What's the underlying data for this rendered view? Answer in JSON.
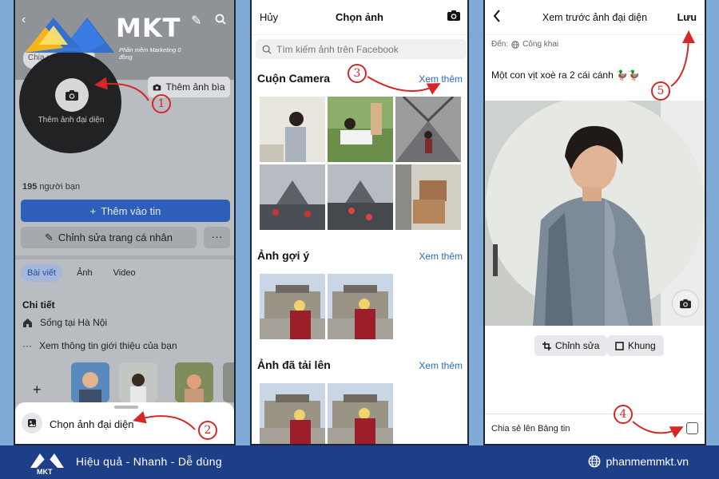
{
  "panel1": {
    "logo": {
      "text": "MKT",
      "subtitle": "Phần mềm Marketing 0 đồng"
    },
    "share_placeholder": "Chia sẻ bài hát...",
    "avatar_label": "Thêm ảnh đại diện",
    "add_cover_label": "Thêm ảnh bìa",
    "friends_count": "195",
    "friends_label": "người bạn",
    "add_story_label": "Thêm vào tin",
    "edit_profile_label": "Chỉnh sửa trang cá nhân",
    "more_label": "···",
    "tabs": [
      {
        "label": "Bài viết",
        "active": true
      },
      {
        "label": "Ảnh",
        "active": false
      },
      {
        "label": "Video",
        "active": false
      }
    ],
    "details_title": "Chi tiết",
    "lives_in_prefix": "Sống tại",
    "lives_in_city": "Hà Nội",
    "see_about": "Xem thông tin giới thiệu của bạn",
    "add_label": "+",
    "sheet_option": "Chọn ảnh đại diện"
  },
  "panel2": {
    "cancel": "Hủy",
    "title": "Chọn ảnh",
    "search_placeholder": "Tìm kiếm ảnh trên Facebook",
    "sections": [
      {
        "title": "Cuộn Camera",
        "link": "Xem thêm"
      },
      {
        "title": "Ảnh gợi ý",
        "link": "Xem thêm"
      },
      {
        "title": "Ảnh đã tải lên",
        "link": "Xem thêm"
      }
    ]
  },
  "panel3": {
    "title": "Xem trước ảnh đại diện",
    "save": "Lưu",
    "to_label": "Đến:",
    "audience": "Công khai",
    "caption": "Một con vịt xoè ra 2 cái cánh 🦆🦆",
    "edit_label": "Chỉnh sửa",
    "frame_label": "Khung",
    "share_to_feed": "Chia sẻ lên Bảng tin",
    "share_checked": false
  },
  "steps": [
    "1",
    "2",
    "3",
    "4",
    "5"
  ],
  "footer": {
    "logo_text": "MKT",
    "slogan": "Hiệu quả - Nhanh - Dễ dùng",
    "website": "phanmemmkt.vn"
  },
  "colors": {
    "accent_blue": "#2e5fb8",
    "link_blue": "#2a69c8",
    "step_red": "#d62727",
    "footer_bg": "#1d3f88",
    "page_bg": "#7fa9d6"
  }
}
